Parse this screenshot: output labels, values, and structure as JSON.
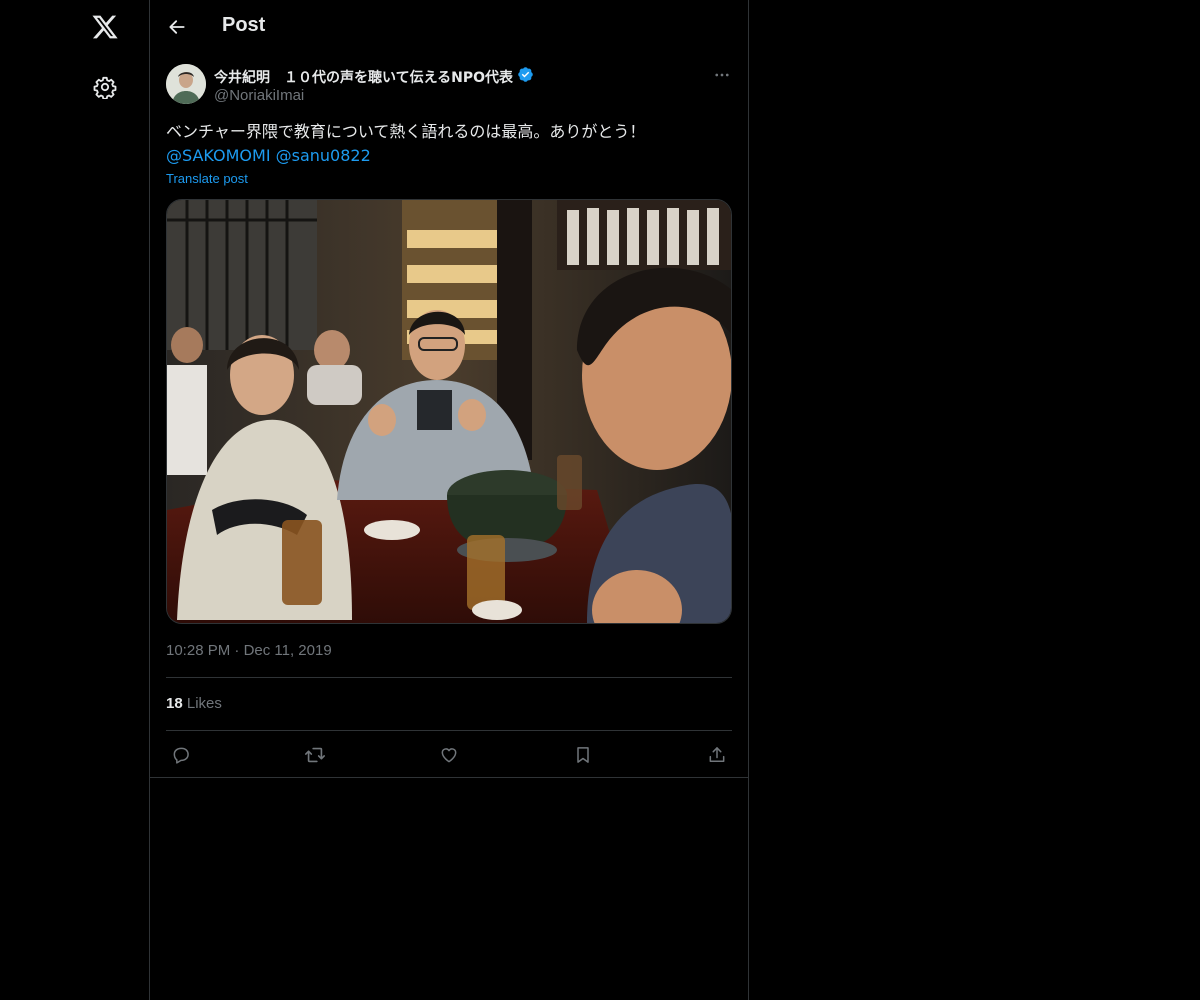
{
  "header": {
    "title": "Post"
  },
  "sidebar": {
    "logo_icon": "x-logo-icon",
    "settings_icon": "gear-icon"
  },
  "post": {
    "author": {
      "name": "今井紀明　１０代の声を聴いて伝えるNPO代表",
      "handle": "@NoriakiImai",
      "verified": true,
      "verified_color": "#1d9bf0"
    },
    "text": "ベンチャー界隈で教育について熱く語れるのは最高。ありがとう！",
    "mentions": [
      "@SAKOMOMI",
      "@sanu0822"
    ],
    "translate_label": "Translate post",
    "time": "10:28 PM",
    "separator": "·",
    "date": "Dec 11, 2019",
    "likes_count": "18",
    "likes_label": "Likes"
  },
  "actions": [
    {
      "name": "reply",
      "icon": "reply-icon"
    },
    {
      "name": "repost",
      "icon": "repost-icon"
    },
    {
      "name": "like",
      "icon": "heart-icon"
    },
    {
      "name": "bookmark",
      "icon": "bookmark-icon"
    },
    {
      "name": "share",
      "icon": "share-icon"
    }
  ],
  "colors": {
    "background": "#000000",
    "text": "#e7e9ea",
    "secondary": "#71767b",
    "accent": "#1d9bf0",
    "border": "#2f3336"
  }
}
